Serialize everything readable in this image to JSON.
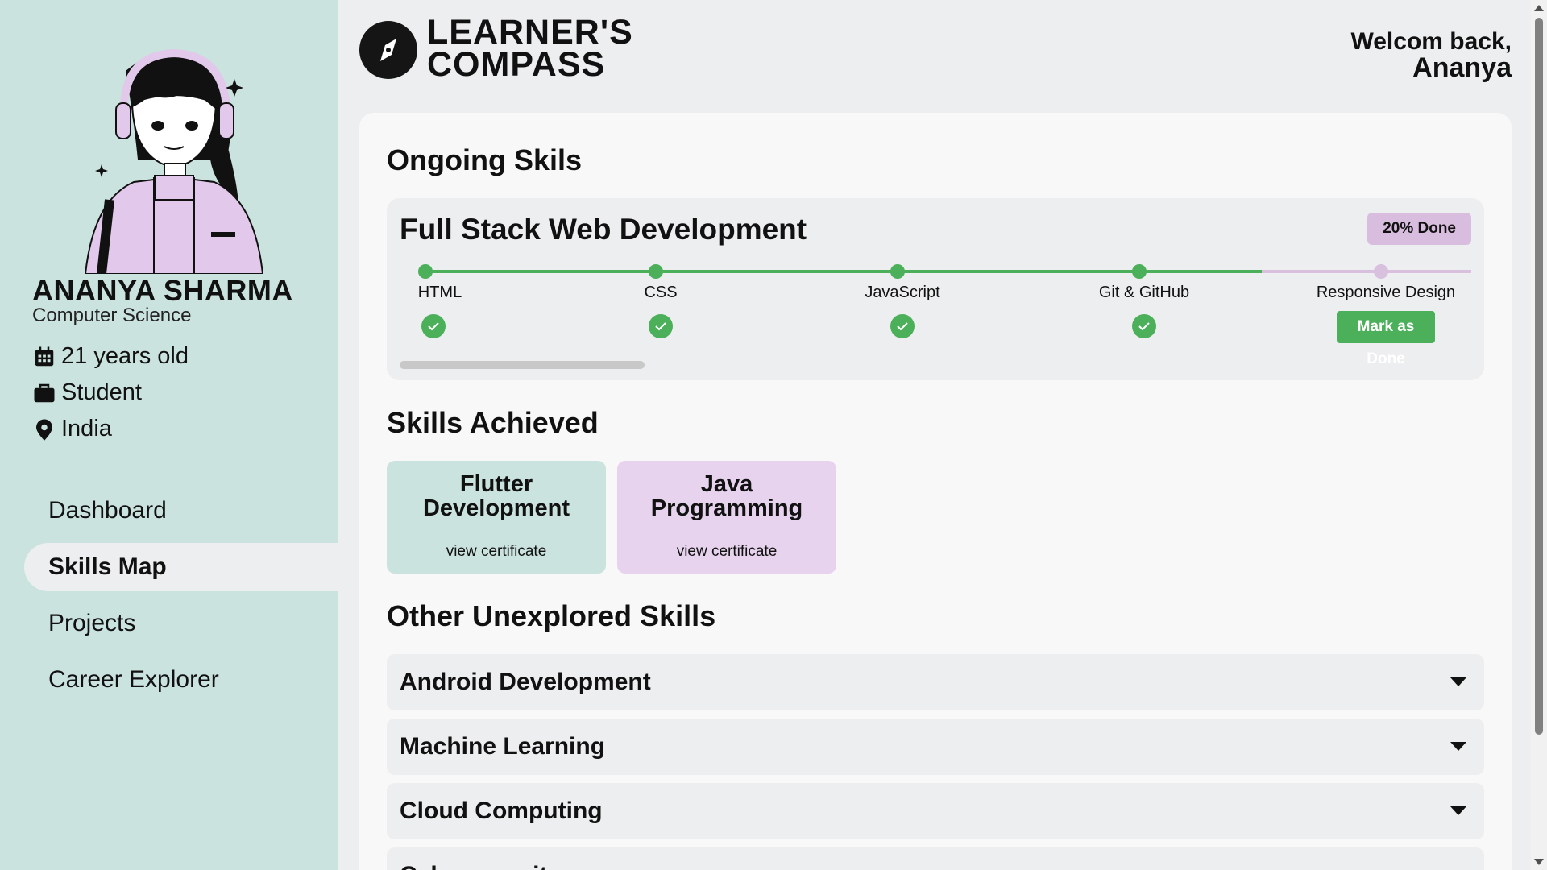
{
  "sidebar": {
    "avatar_icon": "person-with-headphones-illustration",
    "name": "ANANYA SHARMA",
    "major": "Computer Science",
    "info": {
      "age": "21 years old",
      "occupation": "Student",
      "location": "India"
    },
    "nav": [
      {
        "label": "Dashboard",
        "active": false
      },
      {
        "label": "Skills Map",
        "active": true
      },
      {
        "label": "Projects",
        "active": false
      },
      {
        "label": "Career Explorer",
        "active": false
      }
    ]
  },
  "header": {
    "logo_line1": "LEARNER'S",
    "logo_line2": "COMPASS",
    "welcome_line1": "Welcom back,",
    "welcome_line2": "Ananya"
  },
  "ongoing": {
    "title": "Ongoing Skils",
    "course": {
      "title": "Full Stack Web Development",
      "progress_label": "20% Done",
      "completed_fraction": 0.8,
      "steps": [
        {
          "label": "HTML",
          "done": true
        },
        {
          "label": "CSS",
          "done": true
        },
        {
          "label": "JavaScript",
          "done": true
        },
        {
          "label": "Git & GitHub",
          "done": true
        },
        {
          "label": "Responsive Design",
          "done": false
        }
      ],
      "mark_done_label": "Mark as Done"
    }
  },
  "achieved": {
    "title": "Skills Achieved",
    "skills": [
      {
        "line1": "Flutter",
        "line2": "Development",
        "cert": "view certificate",
        "color": "#cbe3de"
      },
      {
        "line1": "Java",
        "line2": "Programming",
        "cert": "view certificate",
        "color": "#e7d3ee"
      }
    ]
  },
  "unexplored": {
    "title": "Other Unexplored Skills",
    "items": [
      "Android Development",
      "Machine Learning",
      "Cloud Computing",
      "Cybersecurity"
    ]
  },
  "colors": {
    "sidebar_bg": "#cbe3de",
    "accent_green": "#4caf5a",
    "accent_purple": "#d9bddf"
  }
}
